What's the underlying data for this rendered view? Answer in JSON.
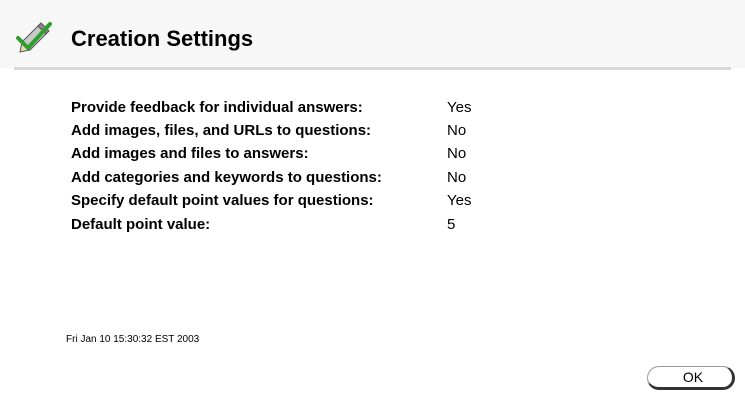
{
  "header": {
    "title": "Creation Settings",
    "icon": "checkmark-pencil-icon"
  },
  "settings": [
    {
      "label": "Provide feedback for individual answers:",
      "value": "Yes"
    },
    {
      "label": "Add images, files, and URLs to questions:",
      "value": "No"
    },
    {
      "label": "Add images and files to answers:",
      "value": "No"
    },
    {
      "label": "Add categories and keywords to questions:",
      "value": "No"
    },
    {
      "label": "Specify default point values for questions:",
      "value": "Yes"
    },
    {
      "label": "Default point value:",
      "value": "5"
    }
  ],
  "footer": {
    "timestamp": "Fri Jan 10 15:30:32 EST 2003",
    "ok_label": "OK"
  },
  "colors": {
    "header_background": "#f7f7f7",
    "rule": "#d9d9d9",
    "check_green": "#2e9e2e"
  }
}
